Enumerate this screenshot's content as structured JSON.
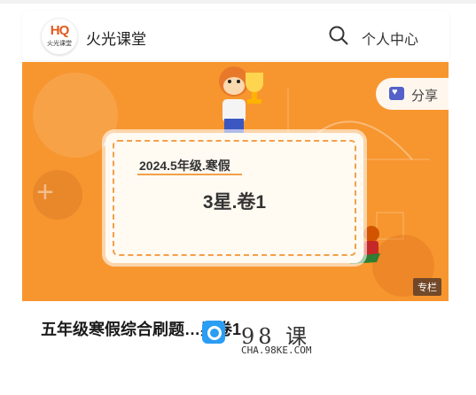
{
  "header": {
    "logo_mark": "HQ",
    "logo_sub": "火光课堂",
    "brand": "火光课堂",
    "search_icon": "search-icon",
    "profile_label": "个人中心"
  },
  "banner": {
    "share_label": "分享",
    "card_line1": "2024.5年级.寒假",
    "card_line2": "3星.卷1",
    "tag": "专栏",
    "background_color": "#f7962f"
  },
  "course": {
    "title": "五年级寒假综合刷题…星卷1"
  },
  "watermark": {
    "big": "98 课",
    "small": "CHA.98KE.COM"
  }
}
